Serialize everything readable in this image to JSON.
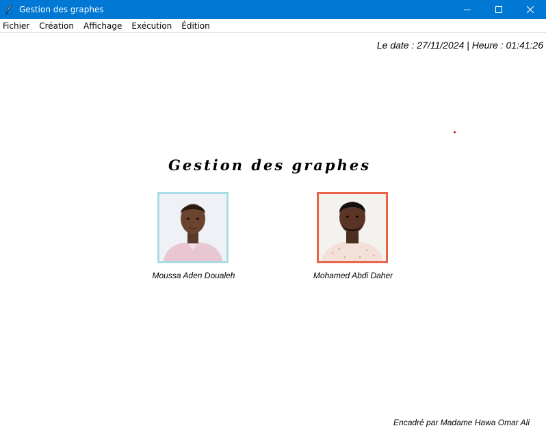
{
  "window": {
    "title": "Gestion des graphes",
    "icon": "feather-icon",
    "controls": [
      "minimize-icon",
      "maximize-icon",
      "close-icon"
    ],
    "accent_color": "#0078d4"
  },
  "menu": {
    "items": [
      "Fichier",
      "Création",
      "Affichage",
      "Exécution",
      "Édition"
    ]
  },
  "header": {
    "datetime": "Le date : 27/11/2024 | Heure : 01:41:26"
  },
  "main": {
    "title": "Gestion des graphes",
    "members": [
      {
        "name": "Moussa Aden Doualeh",
        "frame_color": "#a9dde6"
      },
      {
        "name": "Mohamed Abdi Daher",
        "frame_color": "#e8654a"
      }
    ]
  },
  "footer": {
    "supervisor": "Encadré par Madame Hawa Omar Ali"
  }
}
